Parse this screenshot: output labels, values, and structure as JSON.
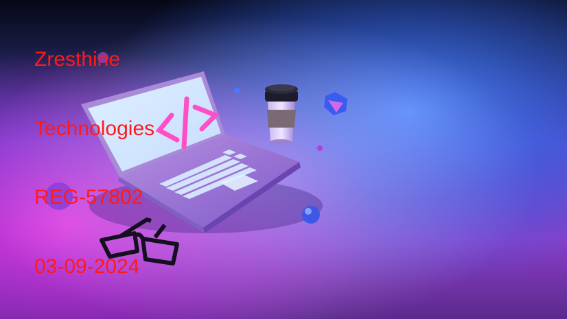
{
  "overlay": {
    "line1": "Zresthine",
    "line2": "Technologies",
    "line3": "REG-57802",
    "line4": "03-09-2024"
  },
  "scene": {
    "subject": "laptop-with-code-icon-coffee-cup-eyeglasses",
    "code_icon_glyph": "</>",
    "colors": {
      "background_top": "#0a0b1e",
      "background_blue": "#2f6de0",
      "background_magenta": "#c02ad0",
      "overlay_text": "#ff1a1a",
      "code_icon": "#ff4fc6"
    }
  }
}
